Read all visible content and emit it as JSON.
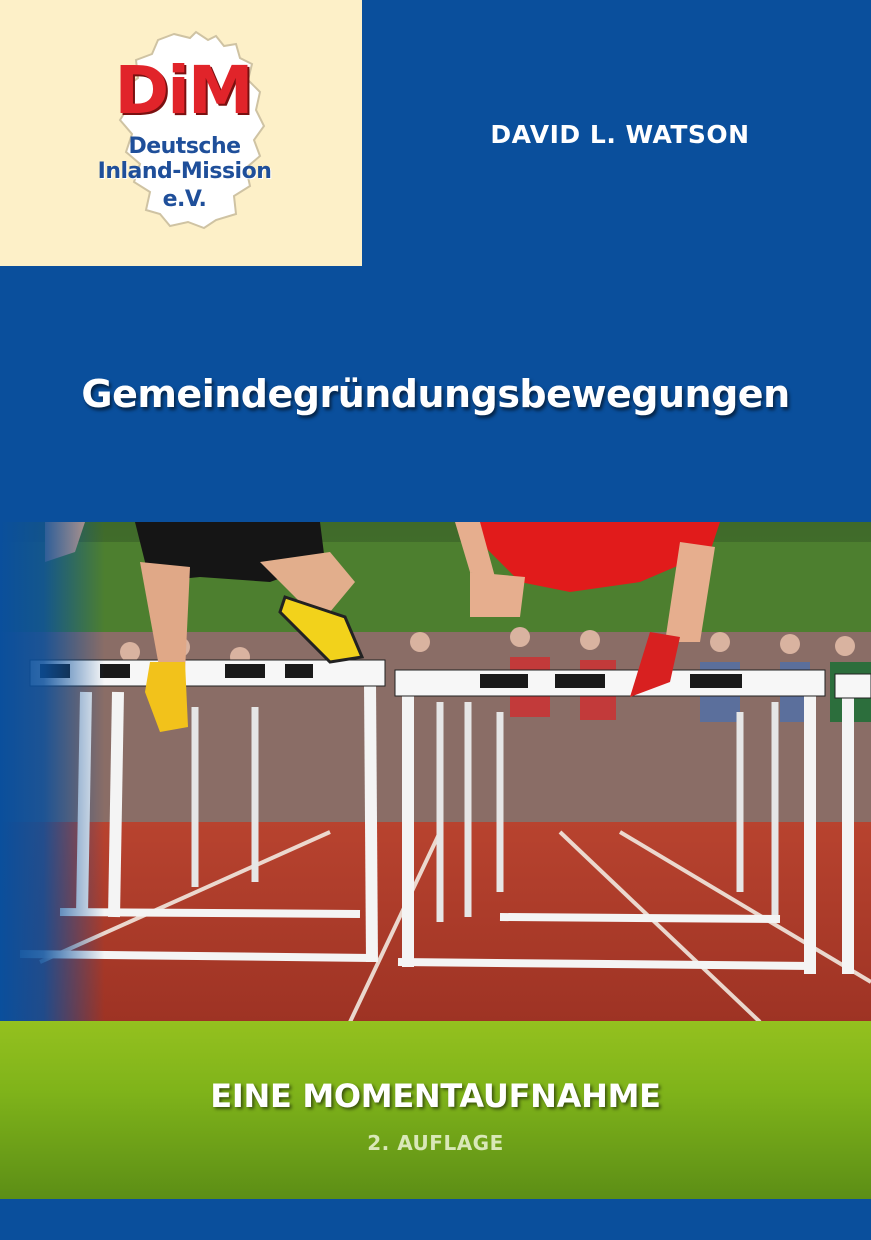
{
  "logo": {
    "mark": "DiM",
    "line1": "Deutsche",
    "line2": "Inland-Mission",
    "line3": "e.V."
  },
  "author": "DAVID L. WATSON",
  "title": "Gemeindegründungsbewegungen",
  "subtitle": "EINE MOMENTAUFNAHME",
  "edition": "2. AUFLAGE",
  "colors": {
    "cover_blue": "#0a4f9c",
    "logo_background": "#fdf0c8",
    "logo_red": "#e1242a",
    "logo_blue": "#1f4f9a",
    "band_green": "#7fb31a"
  }
}
